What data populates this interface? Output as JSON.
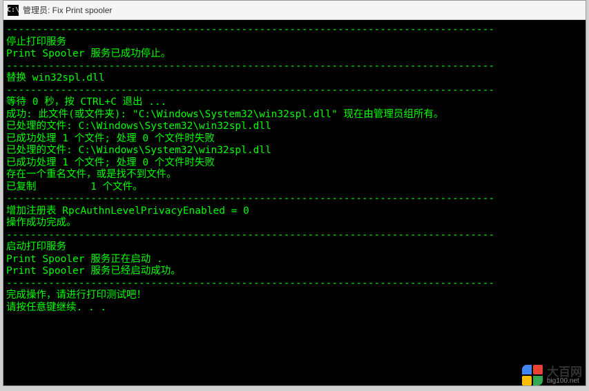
{
  "titlebar": {
    "icon_label": "C:\\",
    "text": "管理员:  Fix Print spooler"
  },
  "terminal": {
    "lines": [
      "---------------------------------------------------------------------------------",
      "停止打印服务",
      "",
      "Print Spooler 服务已成功停止。",
      "",
      "---------------------------------------------------------------------------------",
      "替换 win32spl.dll",
      "---------------------------------------------------------------------------------",
      "",
      "等待 0 秒，按 CTRL+C 退出 ...",
      "",
      "成功: 此文件(或文件夹): \"C:\\Windows\\System32\\win32spl.dll\" 现在由管理员组所有。",
      "已处理的文件: C:\\Windows\\System32\\win32spl.dll",
      "已成功处理 1 个文件; 处理 0 个文件时失败",
      "已处理的文件: C:\\Windows\\System32\\win32spl.dll",
      "已成功处理 1 个文件; 处理 0 个文件时失败",
      "存在一个重名文件，或是找不到文件。",
      "已复制         1 个文件。",
      "---------------------------------------------------------------------------------",
      "增加注册表 RpcAuthnLevelPrivacyEnabled = 0",
      "",
      "操作成功完成。",
      "---------------------------------------------------------------------------------",
      "启动打印服务",
      "Print Spooler 服务正在启动 .",
      "Print Spooler 服务已经启动成功。",
      "",
      "---------------------------------------------------------------------------------",
      "完成操作，请进行打印测试吧！",
      "请按任意键继续. . ."
    ]
  },
  "watermark": {
    "name": "大百网",
    "url": "big100.net"
  }
}
